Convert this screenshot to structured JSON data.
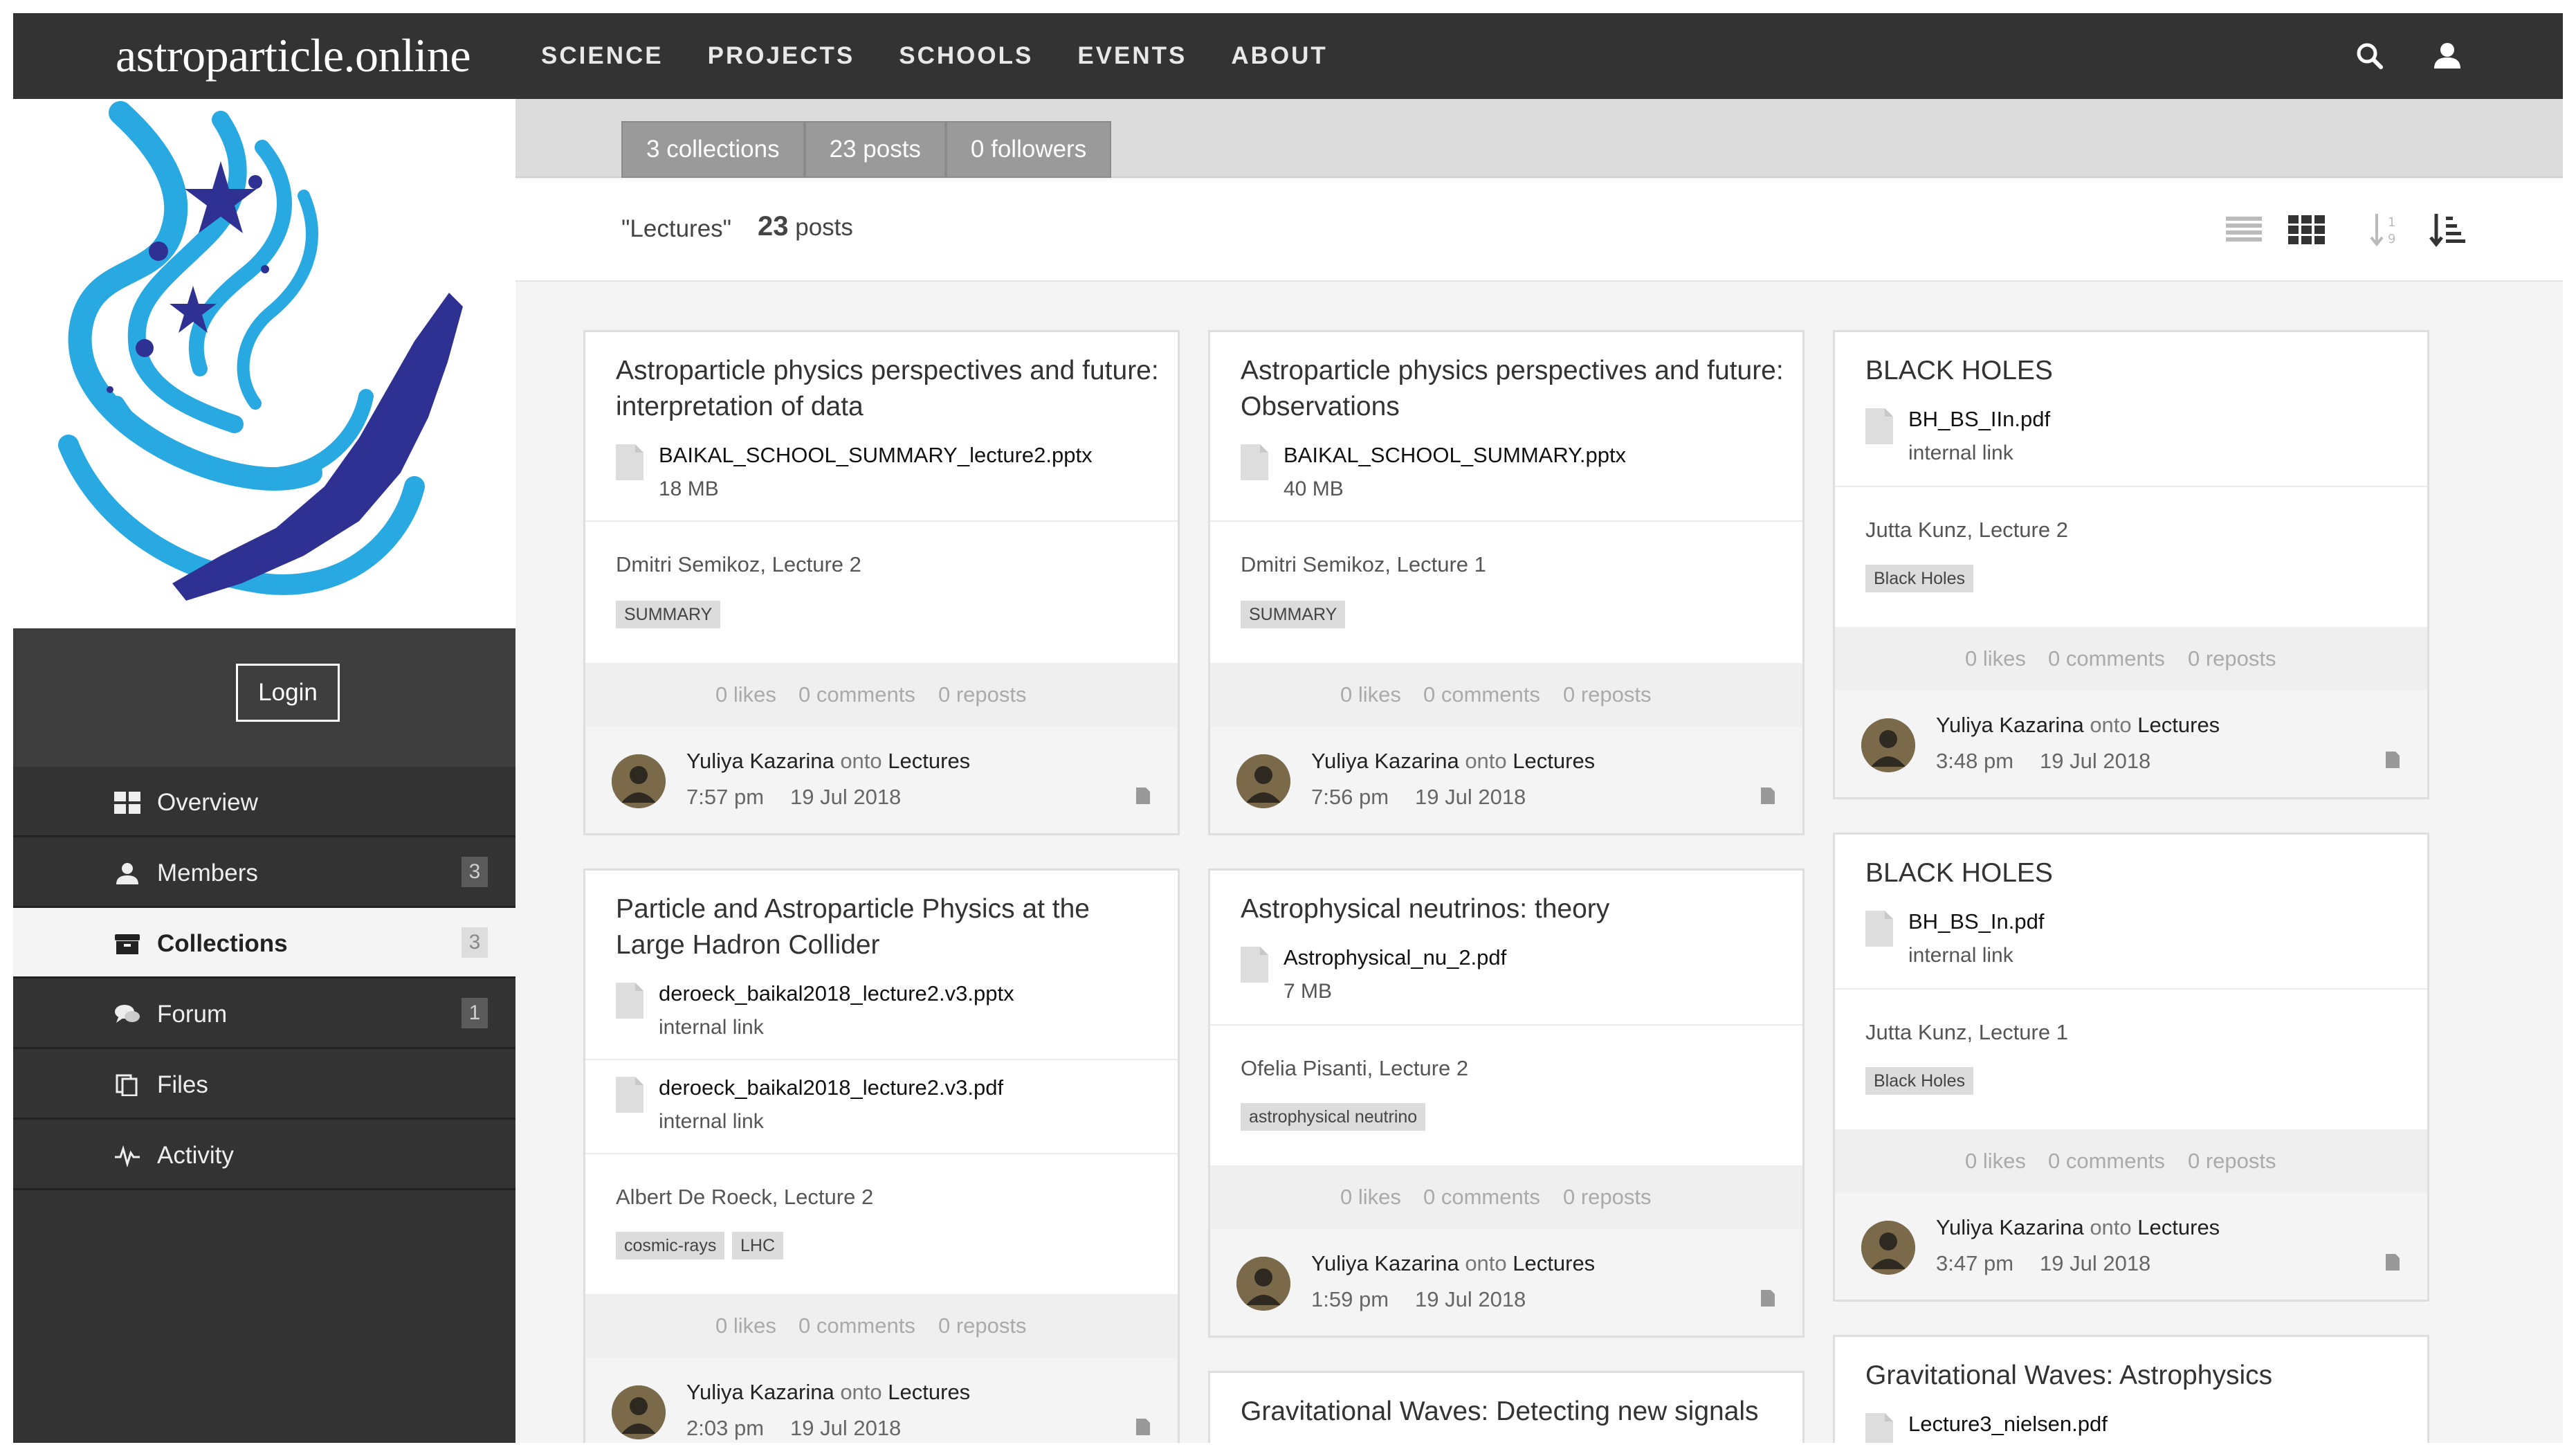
{
  "site": {
    "brand": "astroparticle.online",
    "nav": [
      "SCIENCE",
      "PROJECTS",
      "SCHOOLS",
      "EVENTS",
      "ABOUT"
    ],
    "icons": {
      "search": "search-icon",
      "user": "user-icon"
    }
  },
  "sidebar": {
    "login_label": "Login",
    "items": [
      {
        "label": "Overview",
        "icon": "grid-icon",
        "badge": ""
      },
      {
        "label": "Members",
        "icon": "person-icon",
        "badge": "3"
      },
      {
        "label": "Collections",
        "icon": "archive-icon",
        "badge": "3"
      },
      {
        "label": "Forum",
        "icon": "comments-icon",
        "badge": "1"
      },
      {
        "label": "Files",
        "icon": "files-icon",
        "badge": ""
      },
      {
        "label": "Activity",
        "icon": "pulse-icon",
        "badge": ""
      }
    ]
  },
  "tabs": [
    "3 collections",
    "23 posts",
    "0 followers"
  ],
  "header": {
    "collection": "\"Lectures\"",
    "count": "23",
    "count_label": "posts"
  },
  "cards": [
    {
      "title": "Astroparticle physics perspectives and future: interpretation of data",
      "files": [
        {
          "name": "BAIKAL_SCHOOL_SUMMARY_lecture2.pptx",
          "meta": "18 MB"
        }
      ],
      "description": "Dmitri Semikoz, Lecture 2",
      "tags": [
        "SUMMARY"
      ],
      "likes": "0 likes",
      "comments": "0 comments",
      "reposts": "0 reposts",
      "author": "Yuliya Kazarina",
      "onto": "onto",
      "collection": "Lectures",
      "time": "7:57 pm",
      "date": "19 Jul 2018"
    },
    {
      "title": "Astroparticle physics perspectives and future: Observations",
      "files": [
        {
          "name": "BAIKAL_SCHOOL_SUMMARY.pptx",
          "meta": "40 MB"
        }
      ],
      "description": "Dmitri Semikoz, Lecture 1",
      "tags": [
        "SUMMARY"
      ],
      "likes": "0 likes",
      "comments": "0 comments",
      "reposts": "0 reposts",
      "author": "Yuliya Kazarina",
      "onto": "onto",
      "collection": "Lectures",
      "time": "7:56 pm",
      "date": "19 Jul 2018"
    },
    {
      "title": "BLACK HOLES",
      "files": [
        {
          "name": "BH_BS_IIn.pdf",
          "meta": "internal link"
        }
      ],
      "description": "Jutta Kunz, Lecture 2",
      "tags": [
        "Black Holes"
      ],
      "likes": "0 likes",
      "comments": "0 comments",
      "reposts": "0 reposts",
      "author": "Yuliya Kazarina",
      "onto": "onto",
      "collection": "Lectures",
      "time": "3:48 pm",
      "date": "19 Jul 2018"
    },
    {
      "title": "Particle and Astroparticle Physics at the Large Hadron Collider",
      "files": [
        {
          "name": "deroeck_baikal2018_lecture2.v3.pptx",
          "meta": "internal link"
        },
        {
          "name": "deroeck_baikal2018_lecture2.v3.pdf",
          "meta": "internal link"
        }
      ],
      "description": "Albert De Roeck, Lecture 2",
      "tags": [
        "cosmic-rays",
        "LHC"
      ],
      "likes": "0 likes",
      "comments": "0 comments",
      "reposts": "0 reposts",
      "author": "Yuliya Kazarina",
      "onto": "onto",
      "collection": "Lectures",
      "time": "2:03 pm",
      "date": "19 Jul 2018"
    },
    {
      "title": "Astrophysical neutrinos: theory",
      "files": [
        {
          "name": "Astrophysical_nu_2.pdf",
          "meta": "7 MB"
        }
      ],
      "description": "Ofelia Pisanti, Lecture 2",
      "tags": [
        "astrophysical neutrino"
      ],
      "likes": "0 likes",
      "comments": "0 comments",
      "reposts": "0 reposts",
      "author": "Yuliya Kazarina",
      "onto": "onto",
      "collection": "Lectures",
      "time": "1:59 pm",
      "date": "19 Jul 2018"
    },
    {
      "title": "BLACK HOLES",
      "files": [
        {
          "name": "BH_BS_In.pdf",
          "meta": "internal link"
        }
      ],
      "description": "Jutta Kunz, Lecture 1",
      "tags": [
        "Black Holes"
      ],
      "likes": "0 likes",
      "comments": "0 comments",
      "reposts": "0 reposts",
      "author": "Yuliya Kazarina",
      "onto": "onto",
      "collection": "Lectures",
      "time": "3:47 pm",
      "date": "19 Jul 2018"
    },
    {
      "title": "Gravitational Waves: Detecting new signals"
    },
    {
      "title": "Gravitational Waves: Astrophysics",
      "files": [
        {
          "name": "Lecture3_nielsen.pdf",
          "meta": ""
        }
      ]
    }
  ],
  "colors": {
    "nav_bg": "#333333",
    "logo_light_blue": "#29a9e1",
    "logo_dark_blue": "#2e3192"
  }
}
